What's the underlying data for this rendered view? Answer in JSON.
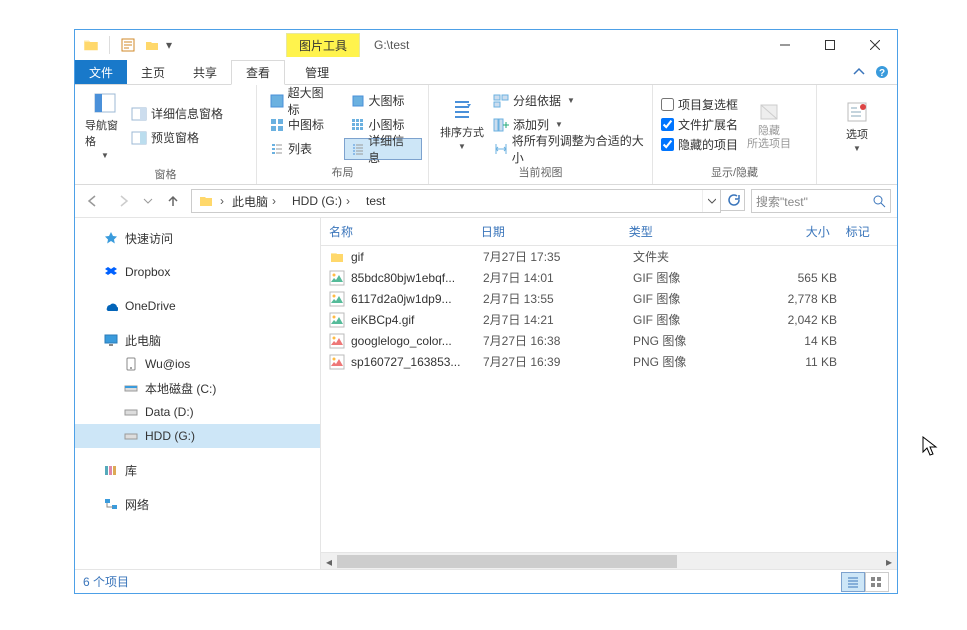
{
  "title_path": "G:\\test",
  "tool_tab": "图片工具",
  "tabs": {
    "file": "文件",
    "home": "主页",
    "share": "共享",
    "view": "查看",
    "manage": "管理"
  },
  "ribbon": {
    "panes_group": "窗格",
    "nav_pane": "导航窗格",
    "detail_pane": "详细信息窗格",
    "preview_pane": "预览窗格",
    "layout_group": "布局",
    "layouts": {
      "xl": "超大图标",
      "l": "大图标",
      "m": "中图标",
      "s": "小图标",
      "list": "列表",
      "details": "详细信息"
    },
    "sort": "排序方式",
    "group_by": "分组依据",
    "add_col": "添加列",
    "autosize": "将所有列调整为合适的大小",
    "current_view_group": "当前视图",
    "item_checkboxes": "项目复选框",
    "file_ext": "文件扩展名",
    "hidden_items": "隐藏的项目",
    "hide": "隐藏\n所选项目",
    "hide_l1": "隐藏",
    "hide_l2": "所选项目",
    "show_hide_group": "显示/隐藏",
    "options": "选项"
  },
  "breadcrumb": {
    "pc": "此电脑",
    "drive": "HDD (G:)",
    "folder": "test"
  },
  "search_placeholder": "搜索\"test\"",
  "columns": {
    "name": "名称",
    "date": "日期",
    "type": "类型",
    "size": "大小",
    "tags": "标记"
  },
  "nav": {
    "quick": "快速访问",
    "dropbox": "Dropbox",
    "onedrive": "OneDrive",
    "pc": "此电脑",
    "wu": "Wu@ios",
    "cdrive": "本地磁盘 (C:)",
    "ddrive": "Data (D:)",
    "gdrive": "HDD (G:)",
    "libs": "库",
    "network": "网络"
  },
  "files": [
    {
      "icon": "folder",
      "name": "gif",
      "date": "7月27日 17:35",
      "type": "文件夹",
      "size": ""
    },
    {
      "icon": "gif",
      "name": "85bdc80bjw1ebqf...",
      "date": "2月7日 14:01",
      "type": "GIF 图像",
      "size": "565 KB"
    },
    {
      "icon": "gif",
      "name": "6117d2a0jw1dp9...",
      "date": "2月7日 13:55",
      "type": "GIF 图像",
      "size": "2,778 KB"
    },
    {
      "icon": "gif",
      "name": "eiKBCp4.gif",
      "date": "2月7日 14:21",
      "type": "GIF 图像",
      "size": "2,042 KB"
    },
    {
      "icon": "png",
      "name": "googlelogo_color...",
      "date": "7月27日 16:38",
      "type": "PNG 图像",
      "size": "14 KB"
    },
    {
      "icon": "png",
      "name": "sp160727_163853...",
      "date": "7月27日 16:39",
      "type": "PNG 图像",
      "size": "11 KB"
    }
  ],
  "status": "6 个项目",
  "checks": {
    "ext": true,
    "hidden": true,
    "boxes": false
  }
}
